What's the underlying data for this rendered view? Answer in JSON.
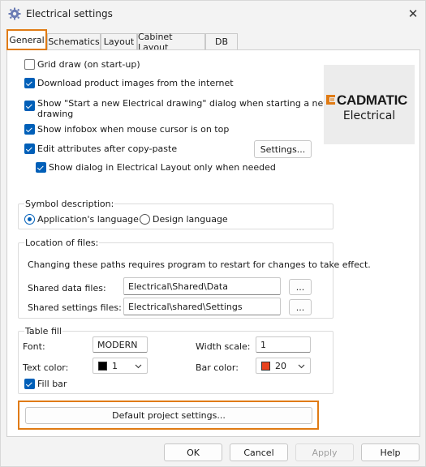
{
  "window": {
    "title": "Electrical settings",
    "close_glyph": "✕"
  },
  "tabs": [
    {
      "label": "General"
    },
    {
      "label": "Schematics"
    },
    {
      "label": "Layout"
    },
    {
      "label": "Cabinet Layout"
    },
    {
      "label": "DB"
    }
  ],
  "general": {
    "checkboxes": [
      {
        "label": "Grid draw (on start-up)",
        "checked": false
      },
      {
        "label": "Download product images from the internet",
        "checked": true
      },
      {
        "label": "Show \"Start a new Electrical drawing\" dialog when starting a new",
        "label2": "drawing",
        "checked": true
      },
      {
        "label": "Show infobox when mouse cursor is on top",
        "checked": true
      },
      {
        "label": "Edit attributes after copy-paste",
        "checked": true
      },
      {
        "label": "Show dialog in Electrical Layout only when needed",
        "checked": true
      }
    ],
    "settings_button": "Settings...",
    "logo": {
      "word": "CADMATIC",
      "sub": "Electrical",
      "accent": "#e07b14"
    }
  },
  "symbol_description": {
    "title": "Symbol description:",
    "options": [
      {
        "label": "Application's language",
        "selected": true
      },
      {
        "label": "Design language",
        "selected": false
      }
    ]
  },
  "location": {
    "title": "Location of files:",
    "note": "Changing these paths requires program to restart for changes to take effect.",
    "shared_data_label": "Shared data files:",
    "shared_data_value": "Electrical\\Shared\\Data",
    "shared_settings_label": "Shared settings files:",
    "shared_settings_value": "Electrical\\shared\\Settings",
    "browse_label": "..."
  },
  "table_fill": {
    "title": "Table fill",
    "font_label": "Font:",
    "font_value": "MODERN",
    "width_scale_label": "Width scale:",
    "width_scale_value": "1",
    "text_color_label": "Text color:",
    "text_color_value": "1",
    "text_color": "#000000",
    "bar_color_label": "Bar color:",
    "bar_color_value": "20",
    "bar_color": "#e8431f",
    "fill_bar_label": "Fill bar",
    "fill_bar_checked": true
  },
  "default_project_button": "Default project settings...",
  "footer": {
    "ok": "OK",
    "cancel": "Cancel",
    "apply": "Apply",
    "help": "Help"
  }
}
